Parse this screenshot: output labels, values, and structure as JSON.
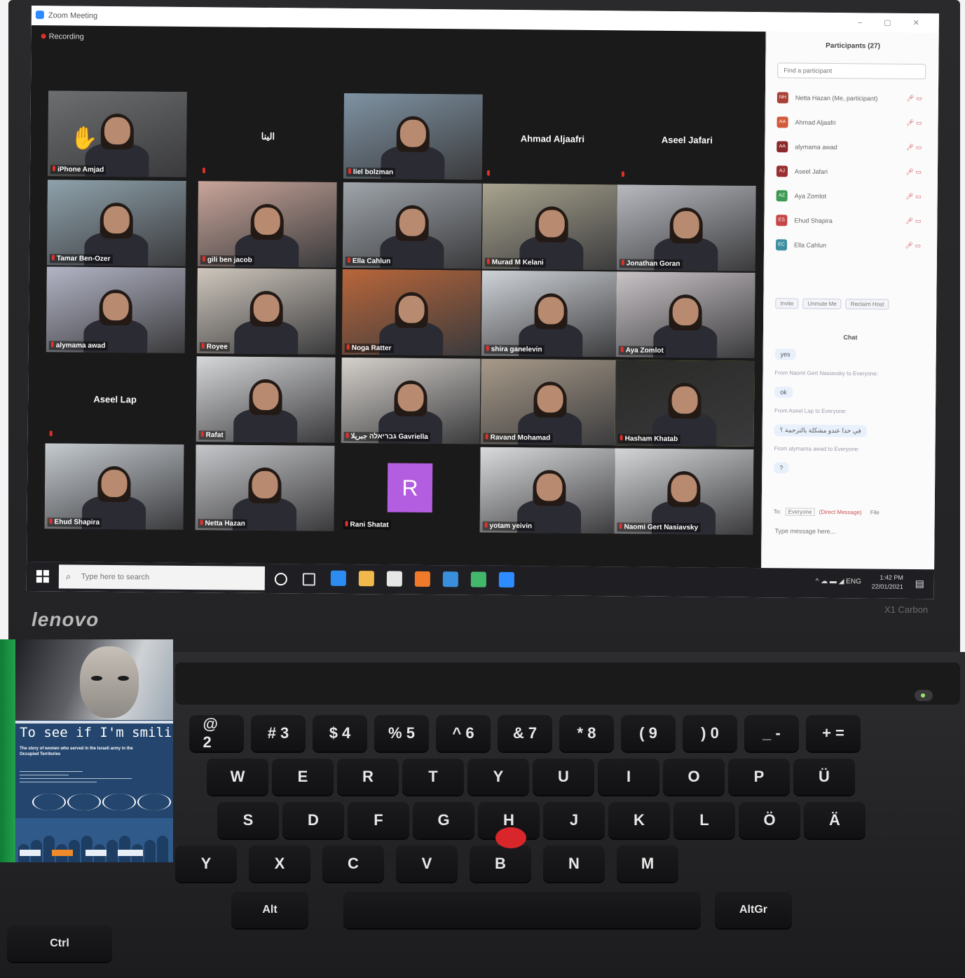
{
  "zoom": {
    "window_title": "Zoom Meeting",
    "recording_label": "Recording",
    "tiles": [
      {
        "name": "iPhone Amjad",
        "kind": "video",
        "bg": "#6c6e70",
        "hand": true
      },
      {
        "name": "الينا",
        "kind": "name",
        "bg": "#1a1a1a"
      },
      {
        "name": "liel bolzman",
        "kind": "video",
        "bg": "#7f93a3"
      },
      {
        "name": "Ahmad Aljaafri",
        "kind": "name",
        "bg": "#1a1a1a"
      },
      {
        "name": "Aseel Jafari",
        "kind": "name",
        "bg": "#1a1a1a"
      },
      {
        "name": "Tamar Ben-Ozer",
        "kind": "video",
        "bg": "#8fa2ac"
      },
      {
        "name": "gili ben jacob",
        "kind": "video",
        "bg": "#c9a59a"
      },
      {
        "name": "Ella Cahlun",
        "kind": "video",
        "bg": "#9fa5ab"
      },
      {
        "name": "Murad M Kelani",
        "kind": "video",
        "bg": "#a9a48f"
      },
      {
        "name": "Jonathan Goran",
        "kind": "video",
        "bg": "#b7b9bf"
      },
      {
        "name": "alymama awad",
        "kind": "video",
        "bg": "#b3b5c6"
      },
      {
        "name": "Royee",
        "kind": "video",
        "bg": "#cfc7bd"
      },
      {
        "name": "Noga Ratter",
        "kind": "video",
        "bg": "#b9663a"
      },
      {
        "name": "shira ganelevin",
        "kind": "video",
        "bg": "#cfd3d8"
      },
      {
        "name": "Aya Zomlot",
        "kind": "video",
        "bg": "#c9c3c6"
      },
      {
        "name": "Aseel Lap",
        "kind": "name",
        "bg": "#1a1a1a"
      },
      {
        "name": "Rafat",
        "kind": "video",
        "bg": "#d7d8da"
      },
      {
        "name": "גבריאלה جبريلا Gavriella",
        "kind": "video",
        "bg": "#d5d1cc"
      },
      {
        "name": "Ravand Mohamad",
        "kind": "video",
        "bg": "#a89b8a"
      },
      {
        "name": "Hasham Khatab",
        "kind": "video",
        "bg": "#2a2a28",
        "active": true
      },
      {
        "name": "Ehud Shapira",
        "kind": "video",
        "bg": "#c5cbd0"
      },
      {
        "name": "Netta Hazan",
        "kind": "video",
        "bg": "#c6c7ca"
      },
      {
        "name": "Rani Shatat",
        "kind": "avatar",
        "bg": "#1a1a1a",
        "avatar_letter": "R"
      },
      {
        "name": "yotam yeivin",
        "kind": "video",
        "bg": "#dadbdd"
      },
      {
        "name": "Naomi Gert Nasiavsky",
        "kind": "video",
        "bg": "#d4d6d8"
      }
    ]
  },
  "panel": {
    "title": "Participants (27)",
    "search_placeholder": "Find a participant",
    "participants": [
      {
        "initials": "NH",
        "name": "Netta Hazan (Me, participant)",
        "color": "#a84236"
      },
      {
        "initials": "AA",
        "name": "Ahmad Aljaafri",
        "color": "#d05a3a"
      },
      {
        "initials": "AA",
        "name": "alymama awad",
        "color": "#8a2a2a"
      },
      {
        "initials": "AJ",
        "name": "Aseel Jafari",
        "color": "#9a2f2f"
      },
      {
        "initials": "AZ",
        "name": "Aya Zomlot",
        "color": "#3d9a52"
      },
      {
        "initials": "ES",
        "name": "Ehud Shapira",
        "color": "#c44646"
      },
      {
        "initials": "EC",
        "name": "Ella Cahlun",
        "color": "#3d8ea0"
      }
    ],
    "buttons": [
      "Invite",
      "Unmute Me",
      "Reclaim Host"
    ],
    "chat_title": "Chat",
    "chat": [
      {
        "type": "bubble",
        "text": "yes"
      },
      {
        "type": "meta",
        "text": "From Naomi Gert Nasiavsky to Everyone:"
      },
      {
        "type": "bubble",
        "text": "ok"
      },
      {
        "type": "meta",
        "text": "From Aseel Lap to Everyone:"
      },
      {
        "type": "bubble",
        "text": "في حدا عندو مشكلة بالترجمة ؟"
      },
      {
        "type": "meta",
        "text": "From alymama awad to Everyone:"
      },
      {
        "type": "bubble",
        "text": "?"
      }
    ],
    "to_label": "To:",
    "to_value": "Everyone",
    "direct_label": "(Direct Message)",
    "file_label": "File",
    "chat_placeholder": "Type message here..."
  },
  "taskbar": {
    "search_placeholder": "Type here to search",
    "lang": "ENG",
    "time": "1:42 PM",
    "date": "22/01/2021",
    "icon_colors": [
      "#ffffff",
      "#dddddd",
      "#2d8cf0",
      "#f2b84b",
      "#e6e6e6",
      "#f07a2a",
      "#3a8fdc",
      "#44b86a",
      "#2d8cff"
    ]
  },
  "laptop": {
    "brand": "lenovo",
    "model": "X1 Carbon"
  },
  "keyboard": {
    "keys": [
      "@ 2",
      "# 3",
      "$ 4",
      "% 5",
      "^ 6",
      "& 7",
      "* 8",
      "( 9",
      ") 0",
      "_ -",
      "+ =",
      "W",
      "E",
      "R",
      "T",
      "Y",
      "U",
      "I",
      "O",
      "P",
      "Ü",
      "S",
      "D",
      "F",
      "G",
      "H",
      "J",
      "K",
      "L",
      "Ö",
      "Ä",
      "Y",
      "X",
      "C",
      "V",
      "B",
      "N",
      "M",
      "Alt",
      "AltGr",
      "Ctrl"
    ]
  },
  "poster": {
    "title": "To see if I'm smiling",
    "subtitle": "The story of women who served in the Israeli army in the Occupied Territories"
  }
}
